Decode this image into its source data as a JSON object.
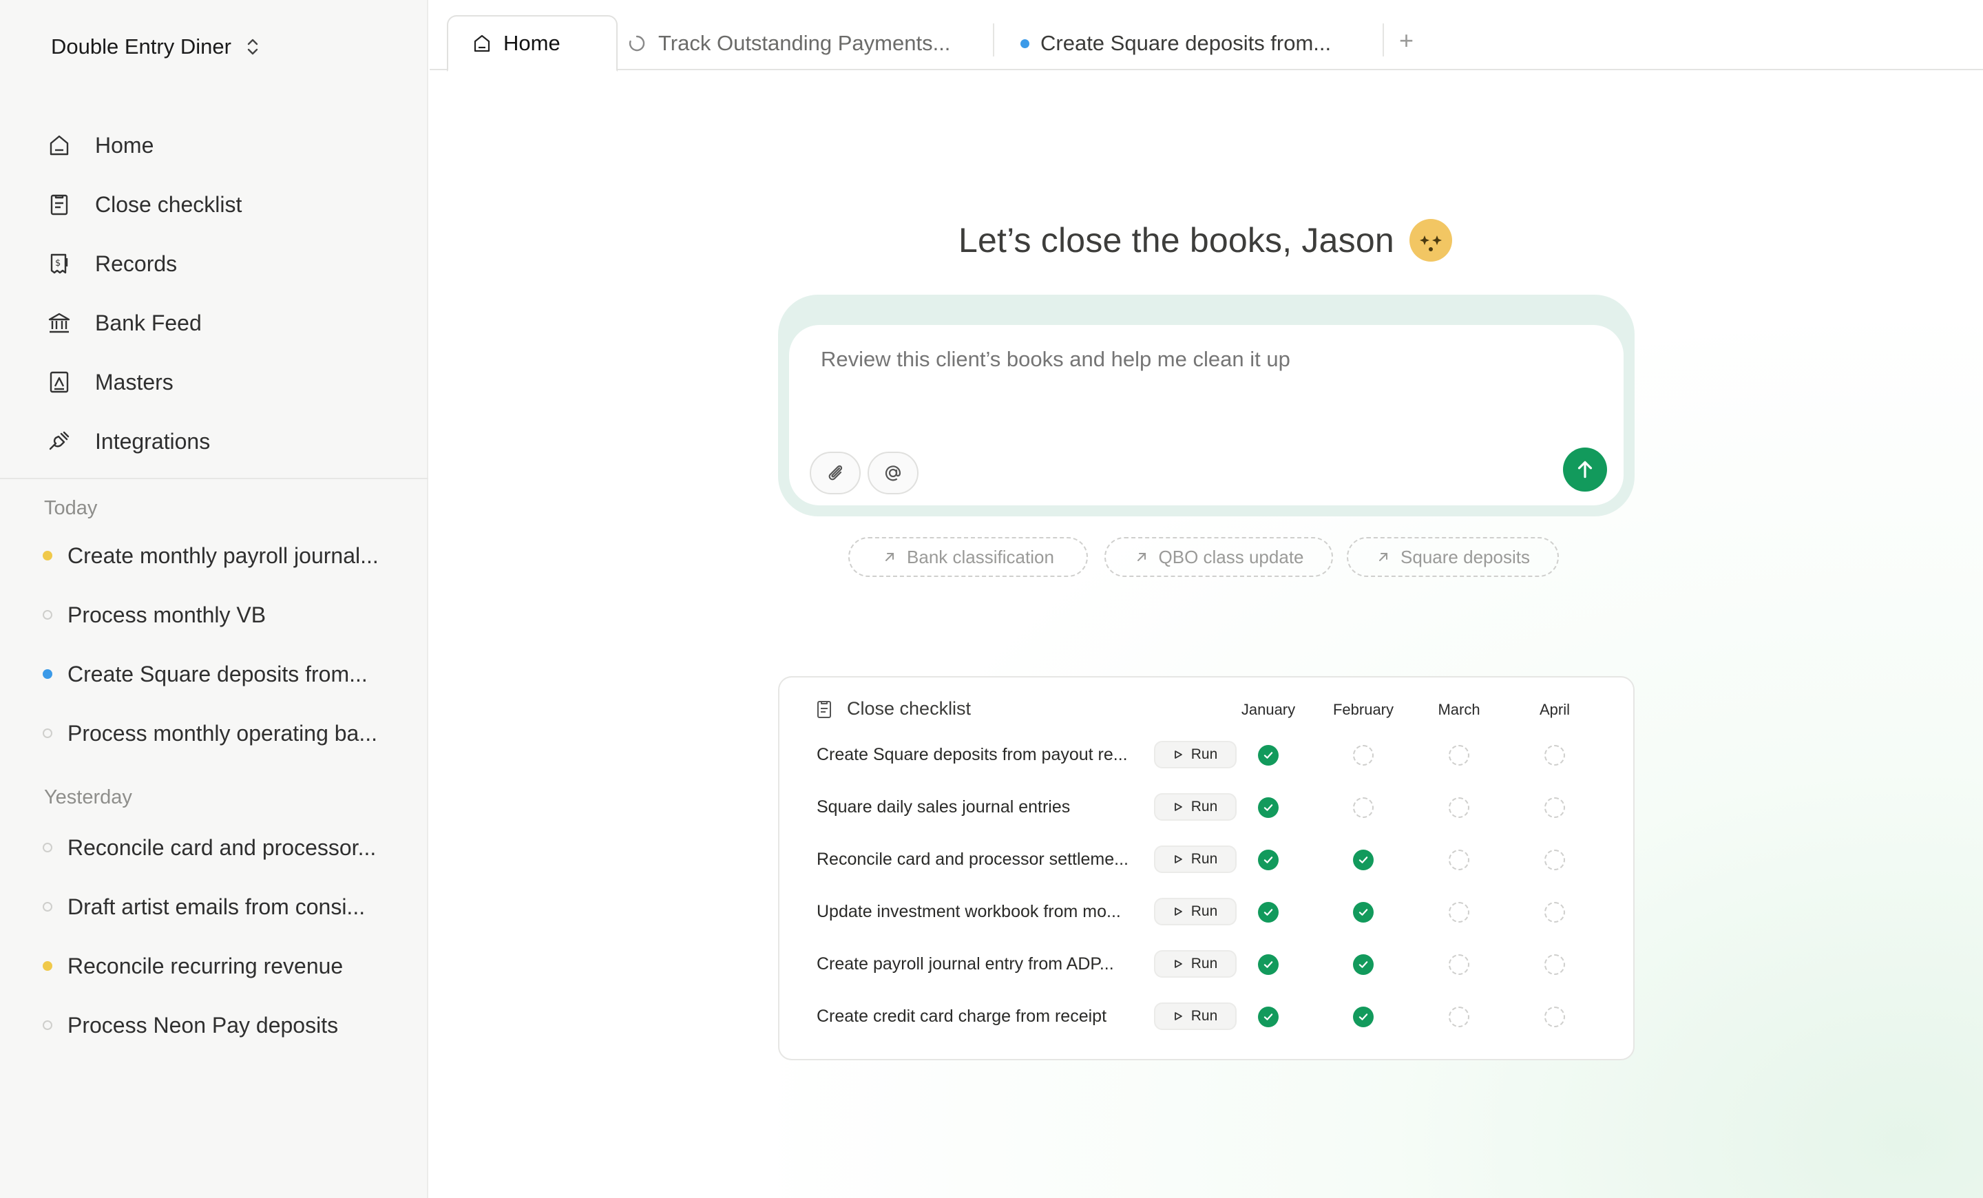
{
  "sidebar": {
    "workspace": "Double Entry Diner",
    "nav": [
      {
        "label": "Home",
        "icon": "home-icon"
      },
      {
        "label": "Close checklist",
        "icon": "clipboard-icon"
      },
      {
        "label": "Records",
        "icon": "receipt-icon"
      },
      {
        "label": "Bank Feed",
        "icon": "bank-icon"
      },
      {
        "label": "Masters",
        "icon": "contact-book-icon"
      },
      {
        "label": "Integrations",
        "icon": "plug-icon"
      }
    ],
    "groups": [
      {
        "label": "Today",
        "items": [
          {
            "label": "Create monthly payroll journal...",
            "status": "yellow"
          },
          {
            "label": "Process monthly VB",
            "status": "empty"
          },
          {
            "label": "Create Square deposits from...",
            "status": "blue"
          },
          {
            "label": "Process monthly operating ba...",
            "status": "empty"
          }
        ]
      },
      {
        "label": "Yesterday",
        "items": [
          {
            "label": "Reconcile card and processor...",
            "status": "empty"
          },
          {
            "label": "Draft artist emails from consi...",
            "status": "empty"
          },
          {
            "label": "Reconcile recurring revenue",
            "status": "yellow"
          },
          {
            "label": "Process Neon Pay deposits",
            "status": "empty"
          }
        ]
      }
    ]
  },
  "tabs": [
    {
      "label": "Home",
      "icon": "home-icon"
    },
    {
      "label": "Track Outstanding Payments...",
      "icon": "loading-spinner-icon"
    },
    {
      "label": "Create Square deposits from...",
      "icon": "blue-dot-icon"
    }
  ],
  "tab_add_label": "+",
  "greeting": "Let’s close the books, Jason",
  "composer": {
    "placeholder": "Review this client’s books and help me clean it up"
  },
  "suggestions": [
    "Bank classification",
    "QBO class update",
    "Square deposits"
  ],
  "checklist": {
    "title": "Close checklist",
    "months": [
      "January",
      "February",
      "March",
      "April"
    ],
    "run_label": "Run",
    "rows": [
      {
        "task": "Create Square deposits from payout re...",
        "status": [
          true,
          false,
          false,
          false
        ]
      },
      {
        "task": "Square daily sales journal entries",
        "status": [
          true,
          false,
          false,
          false
        ]
      },
      {
        "task": "Reconcile card and processor settleme...",
        "status": [
          true,
          true,
          false,
          false
        ]
      },
      {
        "task": "Update investment workbook from mo...",
        "status": [
          true,
          true,
          false,
          false
        ]
      },
      {
        "task": "Create payroll journal entry from ADP...",
        "status": [
          true,
          true,
          false,
          false
        ]
      },
      {
        "task": "Create credit card charge from receipt",
        "status": [
          true,
          true,
          false,
          false
        ]
      }
    ]
  },
  "colors": {
    "accent_green": "#129a5c",
    "status_yellow": "#f0c94a",
    "status_blue": "#3b9ae8"
  }
}
